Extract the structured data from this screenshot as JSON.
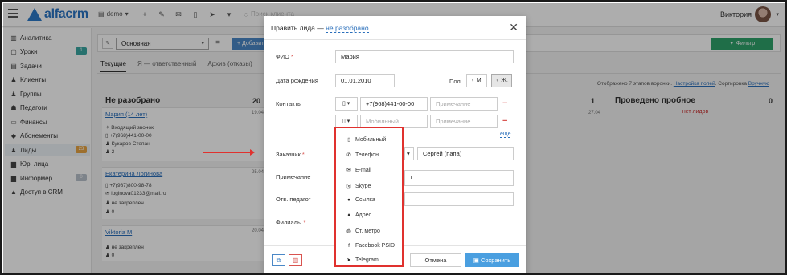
{
  "app": {
    "logo_text": "alfacrm",
    "branch": "demo",
    "search_placeholder": "Поиск клиента",
    "user_name": "Виктория"
  },
  "sidebar": {
    "items": [
      {
        "label": "Аналитика",
        "icon": "chart-icon"
      },
      {
        "label": "Уроки",
        "icon": "calendar-icon",
        "badge": "1",
        "badge_color": "#3aa7a2"
      },
      {
        "label": "Задачи",
        "icon": "tasks-icon"
      },
      {
        "label": "Клиенты",
        "icon": "user-icon"
      },
      {
        "label": "Группы",
        "icon": "group-icon"
      },
      {
        "label": "Педагоги",
        "icon": "teacher-icon"
      },
      {
        "label": "Финансы",
        "icon": "money-icon"
      },
      {
        "label": "Абонементы",
        "icon": "tag-icon"
      },
      {
        "label": "Лиды",
        "icon": "leads-icon",
        "badge": "23",
        "badge_color": "#e8a443"
      },
      {
        "label": "Юр. лица",
        "icon": "building-icon"
      },
      {
        "label": "Информер",
        "icon": "bell-icon",
        "badge": "0",
        "badge_color": "#b9c2cc"
      },
      {
        "label": "Доступ в CRM",
        "icon": "lock-icon"
      }
    ]
  },
  "toolbar": {
    "funnel": "Основная",
    "add_label": "+ Добавить",
    "filter_label": "▼ Фильтр"
  },
  "tabs": [
    {
      "label": "Текущие",
      "active": true
    },
    {
      "label": "Я — ответственный",
      "active": false
    },
    {
      "label": "Архив (отказы)",
      "active": false
    }
  ],
  "board": {
    "col_left_title": "Не разобрано",
    "col_left_count": "20",
    "col1_count": "1",
    "col1_date": "27.04",
    "right_note_prefix": "Отображено 7 этапов воронки.",
    "right_note_link1": "Настройка полей",
    "right_note_mid": ". Сортировка",
    "right_note_link2": "Вручную",
    "probe_title": "Проведено пробное",
    "probe_count": "0",
    "probe_empty": "нет лидов",
    "cards": [
      {
        "name": "Мария (14 лет)",
        "date": "19.04",
        "lines": [
          "✧ Входящий звонок",
          "▯ +7(968)441-00-00",
          "♟ Кукаров Степан",
          "♟ 2"
        ]
      },
      {
        "name": "Екатерина Логинова",
        "date": "25.04",
        "lines": [
          "▯ +7(987)800-98-78",
          "✉ loginova01233@mail.ru",
          "♟ не закреплен",
          "♟ 0"
        ]
      },
      {
        "name": "Viktoria M",
        "date": "20.04",
        "lines": [
          "♟ не закреплен",
          "♟ 0"
        ]
      }
    ]
  },
  "modal": {
    "title": "Править лида —",
    "status": "не разобрано",
    "fields": {
      "fio_label": "ФИО",
      "fio_value": "Мария",
      "dob_label": "Дата рождения",
      "dob_value": "01.01.2010",
      "gender_label": "Пол",
      "gender_m": "♀ М.",
      "gender_f": "♀ Ж.",
      "contacts_label": "Контакты",
      "phone_value": "+7(968)441-00-00",
      "note_placeholder": "Примечание",
      "mobile_placeholder": "Мобильный",
      "more_link": "еще",
      "customer_label": "Заказчик",
      "customer_value": "Сергей (папа)",
      "comment_label": "Примечание",
      "comment_partial": "т",
      "teacher_label": "Отв. педагог",
      "branches_label": "Филиалы"
    },
    "buttons": {
      "cancel": "Отмена",
      "save": "Сохранить"
    }
  },
  "dropdown": {
    "items": [
      {
        "label": "Мобильный",
        "icon": "mobile-icon"
      },
      {
        "label": "Телефон",
        "icon": "phone-icon"
      },
      {
        "label": "E-mail",
        "icon": "email-icon"
      },
      {
        "label": "Skype",
        "icon": "skype-icon"
      },
      {
        "label": "Ссылка",
        "icon": "link-icon"
      },
      {
        "label": "Адрес",
        "icon": "pin-icon"
      },
      {
        "label": "Ст. метро",
        "icon": "metro-icon"
      },
      {
        "label": "Facebook PSID",
        "icon": "facebook-icon"
      },
      {
        "label": "Telegram",
        "icon": "telegram-icon"
      }
    ]
  },
  "colors": {
    "brand_blue": "#2a75c4",
    "highlight_red": "#e0312e",
    "save_blue": "#4a9fe0",
    "filter_green": "#2ea36b"
  }
}
